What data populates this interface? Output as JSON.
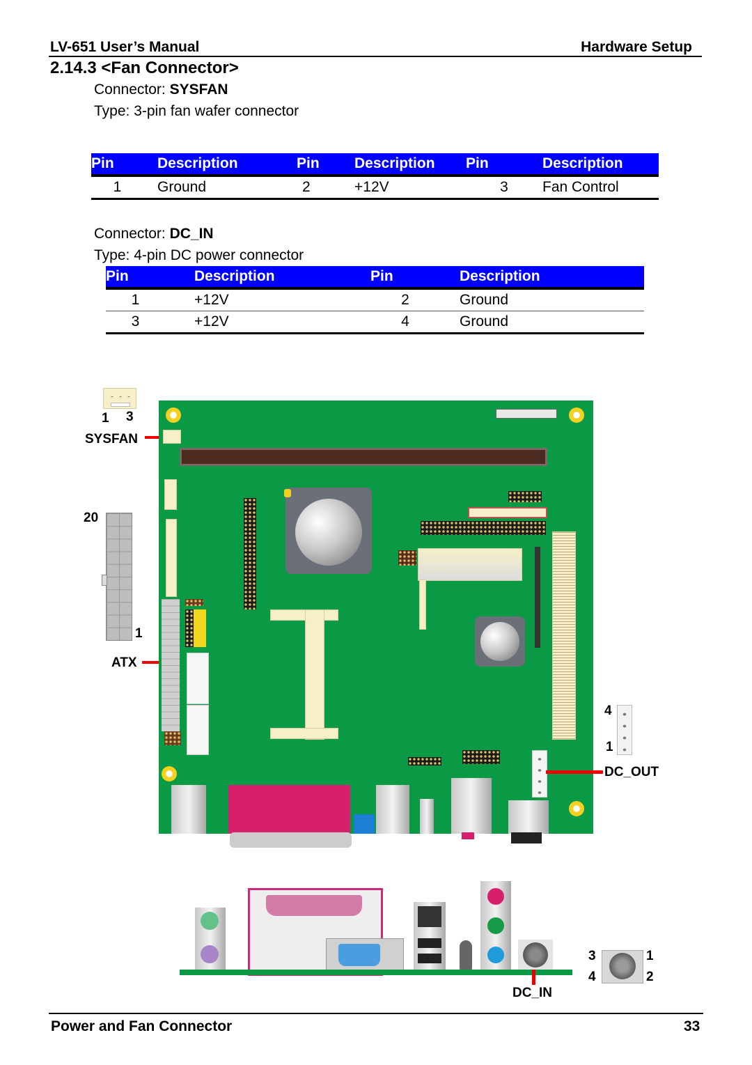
{
  "header": {
    "manual_title": "LV-651 User’s Manual",
    "section": "Hardware Setup"
  },
  "section_title": "2.14.3 <Fan Connector>",
  "sysfan": {
    "connector_label": "Connector: ",
    "connector_name": "SYSFAN",
    "type_text": "Type: 3-pin fan wafer connector",
    "columns": [
      "Pin",
      "Description",
      "Pin",
      "Description",
      "Pin",
      "Description"
    ],
    "rows": [
      [
        "1",
        "Ground",
        "2",
        "+12V",
        "3",
        "Fan Control"
      ]
    ]
  },
  "dcin": {
    "connector_label": "Connector: ",
    "connector_name": "DC_IN",
    "type_text": "Type: 4-pin DC power connector",
    "columns": [
      "Pin",
      "Description",
      "Pin",
      "Description"
    ],
    "rows": [
      [
        "1",
        "+12V",
        "2",
        "Ground"
      ],
      [
        "3",
        "+12V",
        "4",
        "Ground"
      ]
    ]
  },
  "diagram": {
    "sysfan_label": "SYSFAN",
    "sysfan_pin_first": "1",
    "sysfan_pin_last": "3",
    "atx_label": "ATX",
    "atx_pin_top": "20",
    "atx_pin_bottom": "1",
    "dcout_label": "DC_OUT",
    "dcout_pin_top": "4",
    "dcout_pin_bottom": "1",
    "dcin_label": "DC_IN",
    "dcin_pins": {
      "top_left": "3",
      "top_right": "1",
      "bottom_left": "4",
      "bottom_right": "2"
    },
    "colors": {
      "pcb": "#0a9a46",
      "callout": "#ee0000",
      "table_header": "#0000ff"
    }
  },
  "footer": {
    "title": "Power and Fan Connector",
    "page_number": "33"
  }
}
